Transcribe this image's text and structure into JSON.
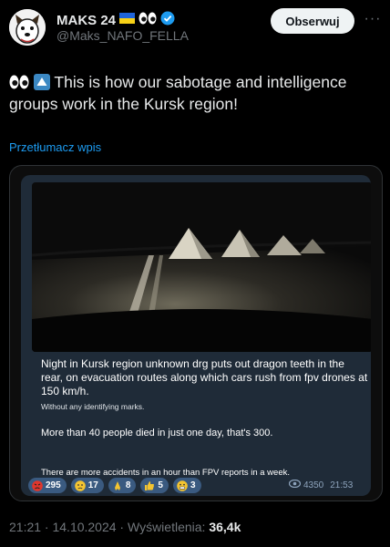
{
  "author": {
    "name": "MAKS 24",
    "handle": "@Maks_NAFO_FELLA",
    "flag_icon": "ukraine-flag-icon",
    "eyes_icon": "eyes-emoji-icon",
    "badge_icon": "verified-badge-icon",
    "badge_color": "#1d9bf0"
  },
  "follow_label": "Obserwuj",
  "more_icon": "more-dots-icon",
  "post": {
    "text": "This is how our sabotage and intelligence groups work in the Kursk region!",
    "translate_label": "Przetłumacz wpis"
  },
  "media": {
    "photo_icon": "night-road-photo",
    "message": {
      "line1": "Night in Kursk region unknown drg puts out dragon teeth in the rear, on evacuation routes along which cars rush from fpv drones at 150 km/h.",
      "line1b": "Without any identifying marks.",
      "line2": "More than 40 people died in just one day, that's 300.",
      "line3": "There are more accidents in an hour than FPV reports in a week."
    },
    "reactions": [
      {
        "icon": "angry-face-icon",
        "count": "295"
      },
      {
        "icon": "sad-face-icon",
        "count": "17"
      },
      {
        "icon": "praying-hands-icon",
        "count": "8"
      },
      {
        "icon": "thumbs-up-icon",
        "count": "5"
      },
      {
        "icon": "grimace-face-icon",
        "count": "3"
      }
    ],
    "views": "4350",
    "time": "21:53"
  },
  "meta": {
    "timestamp": "21:21 · 14.10.2024 · Wyświetlenia:",
    "views": "36,4k"
  }
}
